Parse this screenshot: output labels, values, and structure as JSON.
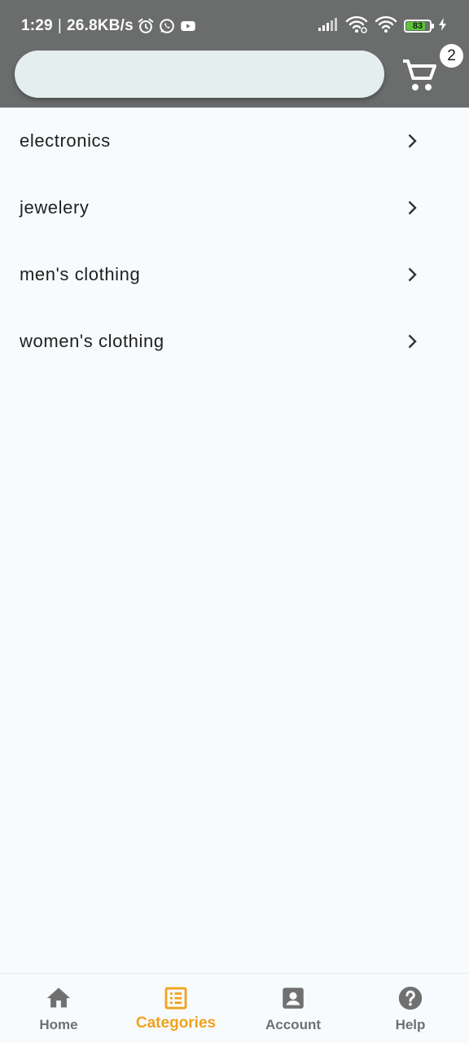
{
  "status_bar": {
    "time": "1:29",
    "separator": "|",
    "network_speed": "26.8KB/s",
    "battery_level": "83",
    "battery_fraction": 0.83,
    "icons": [
      "alarm-icon",
      "whatsapp-icon",
      "youtube-icon",
      "signal-icon",
      "wifi-icon",
      "wifi-icon",
      "battery-icon",
      "charging-icon"
    ]
  },
  "app_bar": {
    "search_value": "",
    "search_placeholder": "",
    "cart_icon": "shopping-cart-icon",
    "cart_count": "2"
  },
  "categories": [
    {
      "label": "electronics",
      "icon": "chevron-right-icon"
    },
    {
      "label": "jewelery",
      "icon": "chevron-right-icon"
    },
    {
      "label": "men's clothing",
      "icon": "chevron-right-icon"
    },
    {
      "label": "women's clothing",
      "icon": "chevron-right-icon"
    }
  ],
  "bottom_nav": {
    "items": [
      {
        "label": "Home",
        "icon": "home-icon",
        "active": false
      },
      {
        "label": "Categories",
        "icon": "list-alt-icon",
        "active": true
      },
      {
        "label": "Account",
        "icon": "account-box-icon",
        "active": false
      },
      {
        "label": "Help",
        "icon": "help-icon",
        "active": false
      }
    ]
  },
  "colors": {
    "app_bar": "#6b6d6d",
    "background": "#f7fbfd",
    "search_field": "#e4eeee",
    "accent": "#f0a21d",
    "inactive_nav": "#707070",
    "battery_fill": "#5ac536"
  }
}
